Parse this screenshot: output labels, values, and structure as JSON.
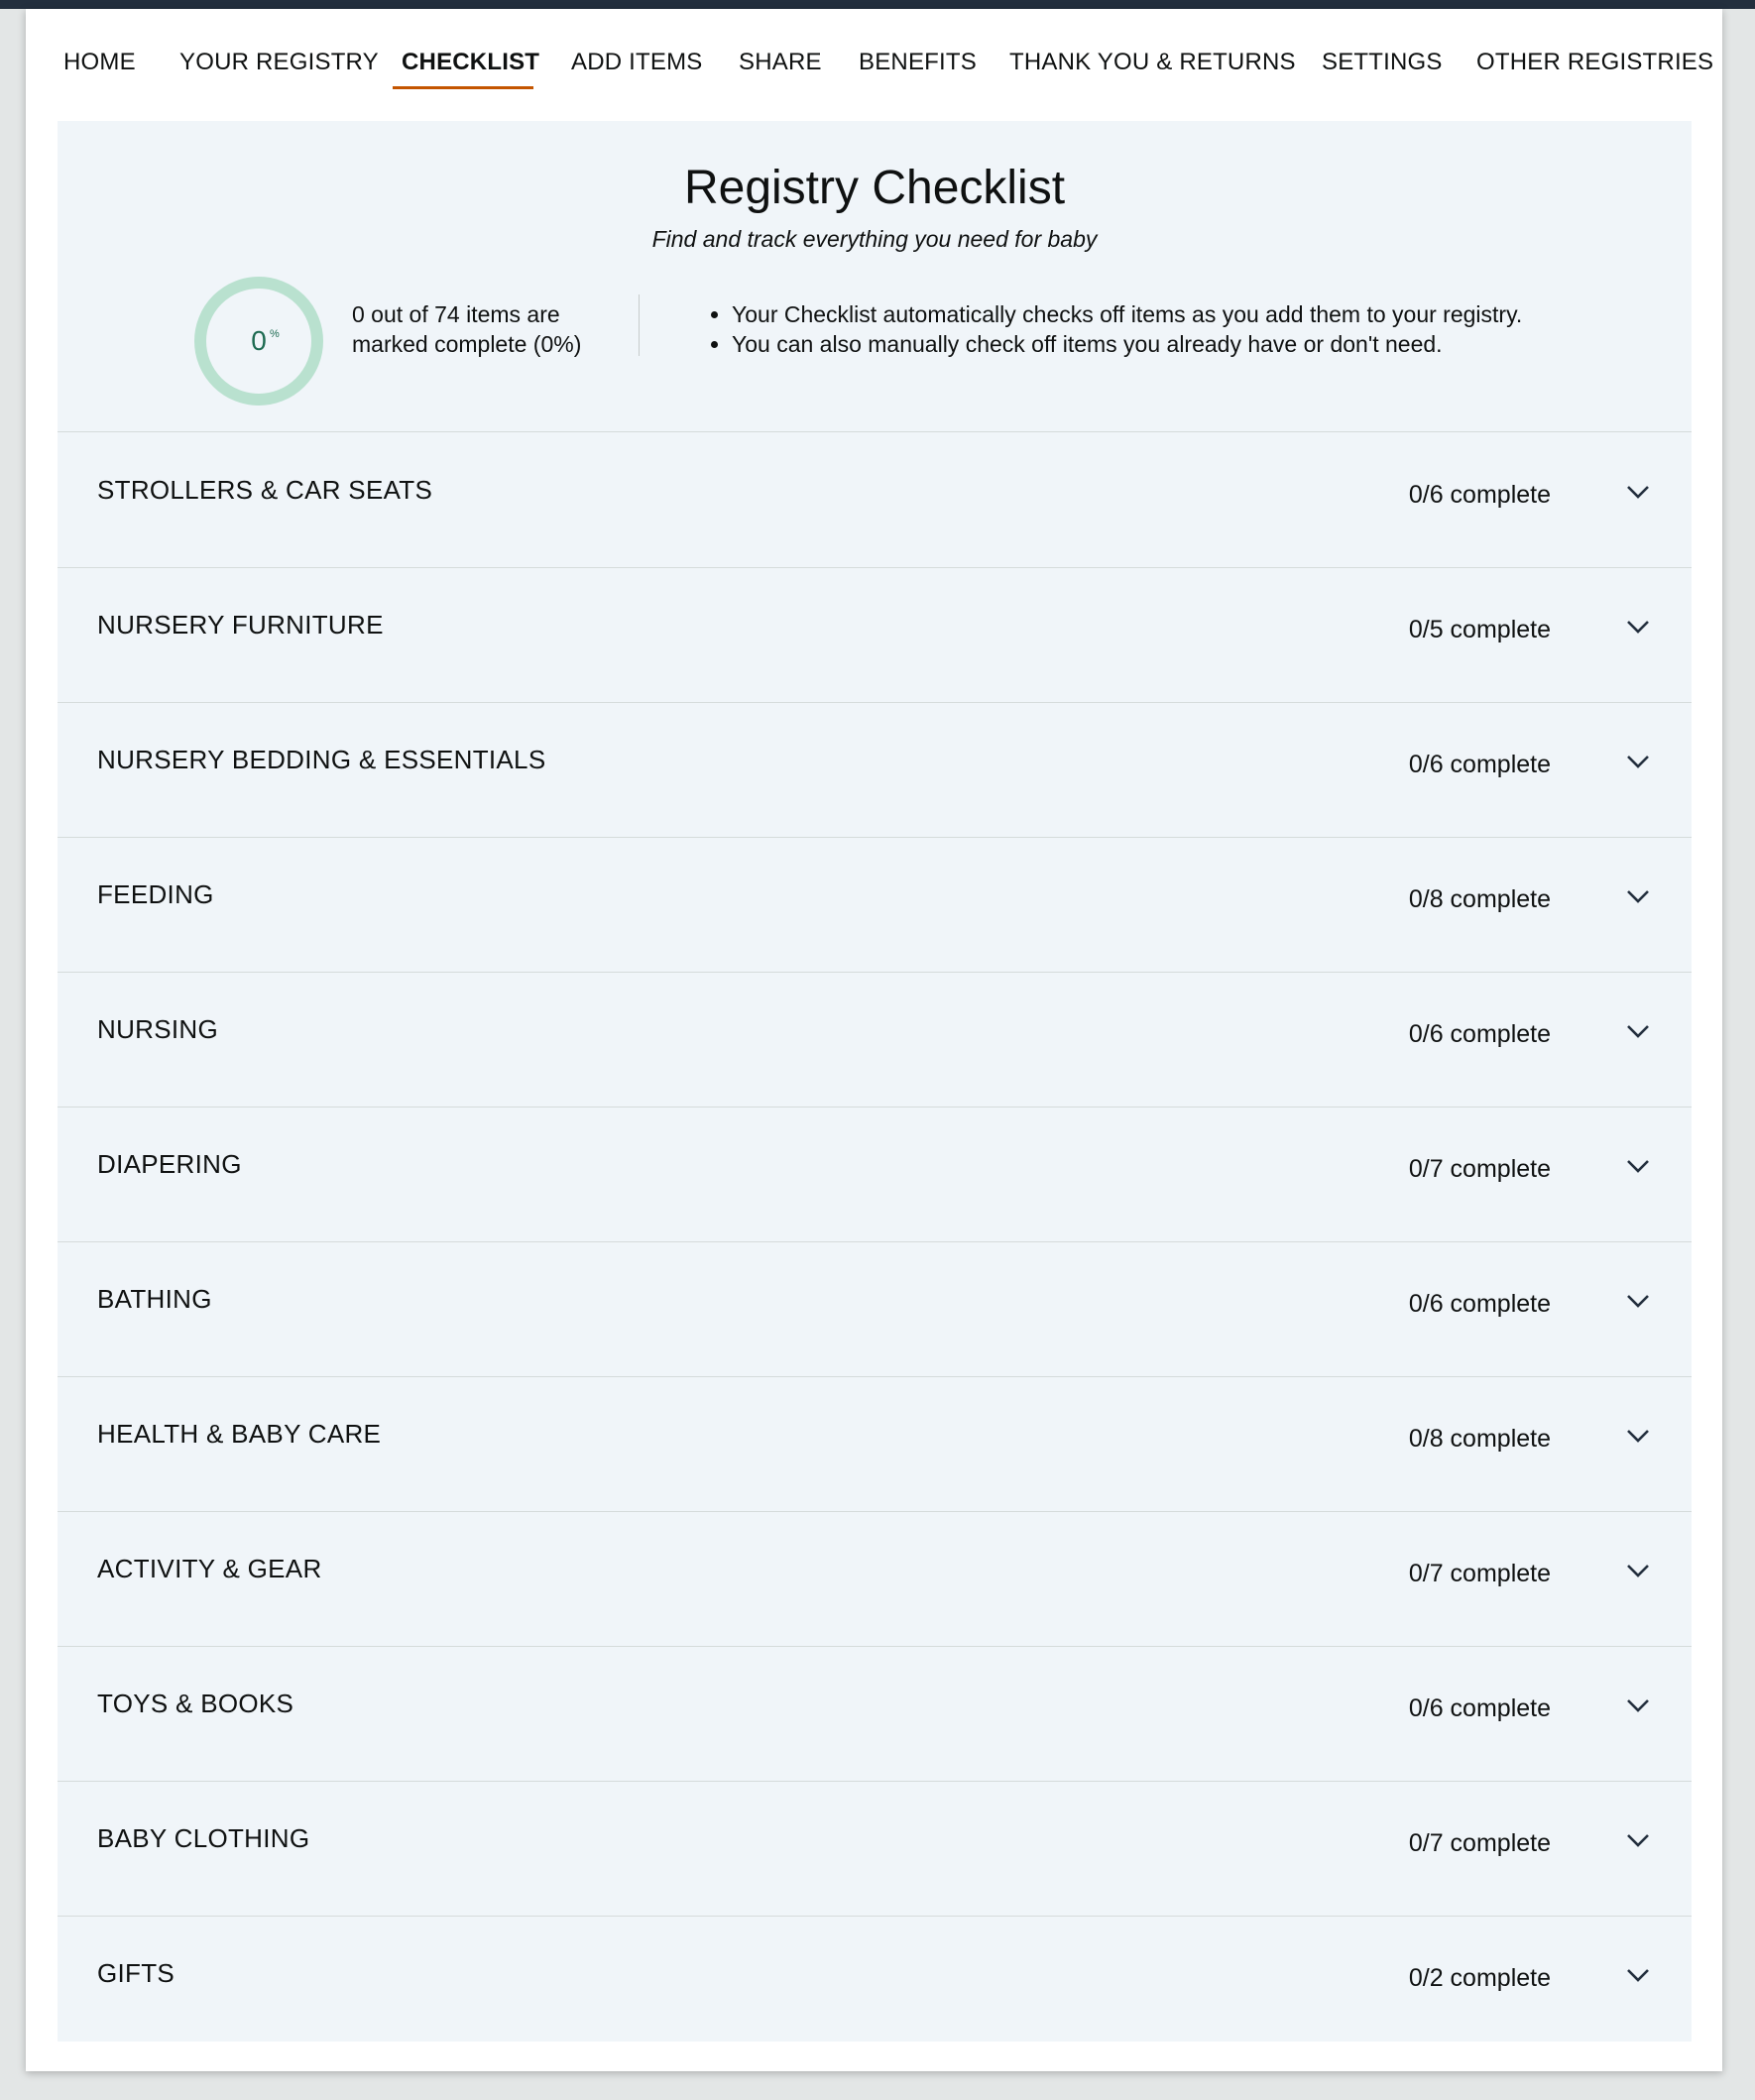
{
  "nav": {
    "items": [
      {
        "label": "HOME"
      },
      {
        "label": "YOUR REGISTRY"
      },
      {
        "label": "CHECKLIST",
        "active": true
      },
      {
        "label": "ADD ITEMS"
      },
      {
        "label": "SHARE"
      },
      {
        "label": "BENEFITS"
      },
      {
        "label": "THANK YOU & RETURNS"
      },
      {
        "label": "SETTINGS"
      },
      {
        "label": "OTHER REGISTRIES"
      }
    ],
    "accent_color": "#c45500"
  },
  "header": {
    "title": "Registry Checklist",
    "subtitle": "Find and track everything you need for baby",
    "progress": {
      "value": "0",
      "unit": "%",
      "fraction": 0,
      "summary": "0 out of 74 items are marked complete (0%)"
    },
    "tips": [
      "Your Checklist automatically checks off items as you add them to your registry.",
      "You can also manually check off items you already have or don't need."
    ]
  },
  "categories": [
    {
      "label": "STROLLERS & CAR SEATS",
      "status": "0/6 complete"
    },
    {
      "label": "NURSERY FURNITURE",
      "status": "0/5 complete"
    },
    {
      "label": "NURSERY BEDDING & ESSENTIALS",
      "status": "0/6 complete"
    },
    {
      "label": "FEEDING",
      "status": "0/8 complete"
    },
    {
      "label": "NURSING",
      "status": "0/6 complete"
    },
    {
      "label": "DIAPERING",
      "status": "0/7 complete"
    },
    {
      "label": "BATHING",
      "status": "0/6 complete"
    },
    {
      "label": "HEALTH & BABY CARE",
      "status": "0/8 complete"
    },
    {
      "label": "ACTIVITY & GEAR",
      "status": "0/7 complete"
    },
    {
      "label": "TOYS & BOOKS",
      "status": "0/6 complete"
    },
    {
      "label": "BABY CLOTHING",
      "status": "0/7 complete"
    },
    {
      "label": "GIFTS",
      "status": "0/2 complete"
    }
  ],
  "icons": {
    "expand": "chevron-down-icon"
  }
}
